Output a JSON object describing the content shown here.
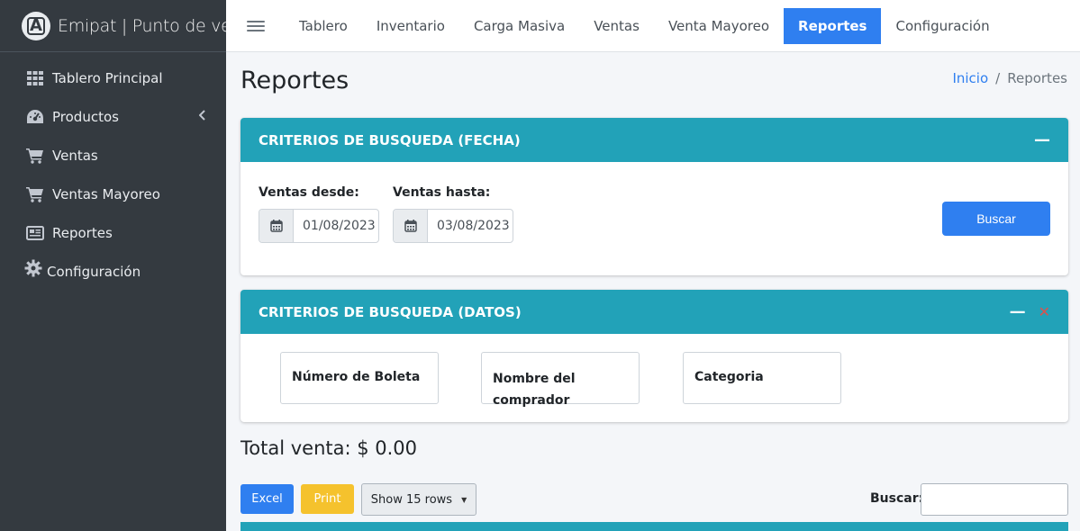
{
  "brand": {
    "name": "Emipat | Punto de venta"
  },
  "sidebar": {
    "items": [
      {
        "label": "Tablero Principal",
        "icon": "grid-icon"
      },
      {
        "label": "Productos",
        "icon": "dashboard-icon",
        "has_chevron": true
      },
      {
        "label": "Ventas",
        "icon": "cart-icon"
      },
      {
        "label": "Ventas Mayoreo",
        "icon": "cart-icon"
      },
      {
        "label": "Reportes",
        "icon": "newspaper-icon"
      },
      {
        "label": "Configuración",
        "icon": "gear-icon"
      }
    ]
  },
  "topnav": {
    "tabs": [
      {
        "label": "Tablero"
      },
      {
        "label": "Inventario"
      },
      {
        "label": "Carga Masiva"
      },
      {
        "label": "Ventas"
      },
      {
        "label": "Venta Mayoreo"
      },
      {
        "label": "Reportes",
        "active": true
      },
      {
        "label": "Configuración"
      }
    ]
  },
  "page": {
    "title": "Reportes",
    "breadcrumb": {
      "home": "Inicio",
      "separator": "/",
      "current": "Reportes"
    }
  },
  "date_card": {
    "title": "CRITERIOS DE BUSQUEDA (FECHA)",
    "collapse_symbol": "—",
    "from_label": "Ventas desde:",
    "from_value": "01/08/2023",
    "to_label": "Ventas hasta:",
    "to_value": "03/08/2023",
    "search_button": "Buscar"
  },
  "data_card": {
    "title": "CRITERIOS DE BUSQUEDA (DATOS)",
    "collapse_symbol": "—",
    "close_symbol": "✕",
    "fields": [
      {
        "label": "Número de Boleta"
      },
      {
        "label": "Nombre del comprador"
      },
      {
        "label": "Categoria"
      }
    ]
  },
  "summary": {
    "total_label": "Total venta: $ 0.00"
  },
  "table_controls": {
    "excel": "Excel",
    "print": "Print",
    "rows": "Show 15 rows",
    "search_label": "Buscar:",
    "search_value": ""
  },
  "colors": {
    "sidebar_bg": "#343a40",
    "accent_blue": "#2f7ff0",
    "card_header": "#22a2b8",
    "print_yellow": "#f5c22d",
    "close_red": "#d9534f"
  }
}
